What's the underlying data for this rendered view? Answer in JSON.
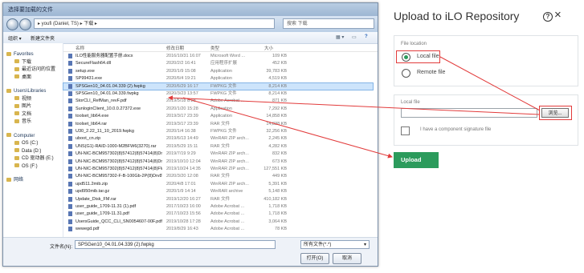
{
  "dialog": {
    "title": "选择要加载的文件",
    "address_path": "▸ youfi (Daniel, TS) ▸ 下载 ▸",
    "search_placeholder": "搜索 下载",
    "toolbar": {
      "organize": "组织 ▾",
      "new_folder": "新建文件夹"
    },
    "nav_items": [
      {
        "label": "Favorites",
        "type": "group"
      },
      {
        "label": "下载",
        "type": "item"
      },
      {
        "label": "最近访问的位置",
        "type": "item"
      },
      {
        "label": "桌面",
        "type": "item"
      },
      {
        "label": "Users\\Libraries",
        "type": "group"
      },
      {
        "label": "视频",
        "type": "item"
      },
      {
        "label": "图片",
        "type": "item"
      },
      {
        "label": "文档",
        "type": "item"
      },
      {
        "label": "音乐",
        "type": "item"
      },
      {
        "label": "Computer",
        "type": "group"
      },
      {
        "label": "OS (C:)",
        "type": "item"
      },
      {
        "label": "Data (D:)",
        "type": "item"
      },
      {
        "label": "CD 驱动器 (E:)",
        "type": "item"
      },
      {
        "label": "OS (F:)",
        "type": "item"
      },
      {
        "label": "网络",
        "type": "group"
      }
    ],
    "columns": {
      "name": "名称",
      "date": "修改日期",
      "type": "类型",
      "size": "大小"
    },
    "files": [
      {
        "name": "ILO性能服务器配置手册.docx",
        "date": "2016/10/31 16:07",
        "type": "Microsoft Word ...",
        "size": "109 KB",
        "selected": false
      },
      {
        "name": "SecureFlash64.dll",
        "date": "2020/2/2 16:41",
        "type": "应用程序扩展",
        "size": "452 KB",
        "selected": false
      },
      {
        "name": "setup.exe",
        "date": "2020/1/9 15:08",
        "type": "Application",
        "size": "39,783 KB",
        "selected": false
      },
      {
        "name": "SP99431.exe",
        "date": "2020/6/4 19:21",
        "type": "Application",
        "size": "4,519 KB",
        "selected": false
      },
      {
        "name": "SPSGen10_04.01.04.339 (2).fwpkg",
        "date": "2020/6/29 16:17",
        "type": "FWPKG 文件",
        "size": "8,214 KB",
        "selected": true
      },
      {
        "name": "SPSGen10_04.01.04.339.fwpkg",
        "date": "2020/3/23 13:57",
        "type": "FWPKG 文件",
        "size": "8,214 KB",
        "selected": false
      },
      {
        "name": "StorCLI_RefMan_revF.pdf",
        "date": "2019/5/18 8:28",
        "type": "Adobe Acrobat ...",
        "size": "871 KB",
        "selected": false
      },
      {
        "name": "SunloginClient_10.0.0.27372.exe",
        "date": "2020/1/20 15:28",
        "type": "Application",
        "size": "7,292 KB",
        "selected": false
      },
      {
        "name": "toolset_lib64.exe",
        "date": "2019/3/17 23:39",
        "type": "Application",
        "size": "14,858 KB",
        "selected": false
      },
      {
        "name": "toolset_lib64.rar",
        "date": "2019/3/17 23:39",
        "type": "RAR 文件",
        "size": "14,838 KB",
        "selected": false
      },
      {
        "name": "U30_2.22_11_10_2019.fwpkg",
        "date": "2020/1/4 16:38",
        "type": "FWPKG 文件",
        "size": "32,256 KB",
        "selected": false
      },
      {
        "name": "uboot_cn.zip",
        "date": "2019/6/13 14:49",
        "type": "WinRAR ZIP arch...",
        "size": "2,245 KB",
        "selected": false
      },
      {
        "name": "UNS(G1)-RAID-1000-M2BFW6(3270).rar",
        "date": "2019/5/29 15:11",
        "type": "RAR 文件",
        "size": "4,282 KB",
        "selected": false
      },
      {
        "name": "UN-NIC-BCM957302(8)57412(8)57414(8)Dm8(Vmwa...",
        "date": "2019/7/19 9:29",
        "type": "WinRAR ZIP arch...",
        "size": "832 KB",
        "selected": false
      },
      {
        "name": "UN-NIC-BCM957302(8)57412(8)57414(8)Dm(Win8...",
        "date": "2019/10/10 12:04",
        "type": "WinRAR ZIP arch...",
        "size": "673 KB",
        "selected": false
      },
      {
        "name": "UN-NIC-BCM957302(8)57412(8)57414(8)FW(8.13...",
        "date": "2019/10/24 14:35",
        "type": "WinRAR ZIP arch...",
        "size": "127,551 KB",
        "selected": false
      },
      {
        "name": "UN-NIC-BCM957302-F-B-100Gb-2P(8)Drv8Win8(20.8.21.0)...",
        "date": "2020/3/20 12:08",
        "type": "RAR 文件",
        "size": "449 KB",
        "selected": false
      },
      {
        "name": "upd511.2mib.zip",
        "date": "2020/4/8 17:01",
        "type": "WinRAR ZIP arch...",
        "size": "5,391 KB",
        "selected": false
      },
      {
        "name": "upd950mib.tar.gz",
        "date": "2020/1/9 14:14",
        "type": "WinRAR archive",
        "size": "5,148 KB",
        "selected": false
      },
      {
        "name": "Update_Disk_FM.rar",
        "date": "2019/12/20 16:27",
        "type": "RAR 文件",
        "size": "410,182 KB",
        "selected": false
      },
      {
        "name": "user_guide_1709-11.31 (1).pdf",
        "date": "2017/10/23 16:00",
        "type": "Adobe Acrobat ...",
        "size": "1,718 KB",
        "selected": false
      },
      {
        "name": "user_guide_1709-11.31.pdf",
        "date": "2017/10/23 15:56",
        "type": "Adobe Acrobat ...",
        "size": "1,718 KB",
        "selected": false
      },
      {
        "name": "UsersGuide_QCC_CLI_SN0054607-00F.pdf",
        "date": "2019/10/28 17:28",
        "type": "Adobe Acrobat ...",
        "size": "3,064 KB",
        "selected": false
      },
      {
        "name": "wewegd.pdf",
        "date": "2019/8/29 16:43",
        "type": "Adobe Acrobat ...",
        "size": "78 KB",
        "selected": false
      }
    ],
    "filename_label": "文件名(N):",
    "filename_value": "SPSGen10_04.01.04.339 (2).fwpkg",
    "filetype_value": "所有文件(*.*)",
    "open_button": "打开(O)",
    "cancel_button": "取消"
  },
  "ilo": {
    "title": "Upload to iLO Repository",
    "file_location_label": "File location",
    "local_file": "Local file",
    "remote_file": "Remote file",
    "local_file_label": "Local file",
    "browse_button": "浏览...",
    "signature_label": "I have a component signature file",
    "upload_button": "Upload",
    "accent_color": "#2c9b5c",
    "highlight_color": "#e23b3b"
  }
}
